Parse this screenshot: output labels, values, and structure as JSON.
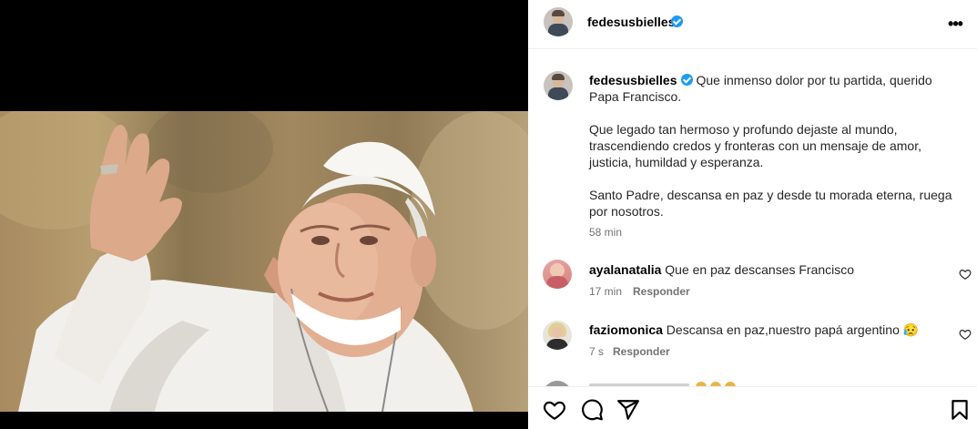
{
  "post": {
    "username": "fedesusbielles",
    "more_icon": "more-horizontal-icon",
    "caption_lines": [
      "Que inmenso dolor por tu partida, querido Papa Francisco.",
      "Que legado tan hermoso y profundo dejaste al mundo, trascendiendo credos y fronteras con un mensaje de amor, justicia, humildad y esperanza.",
      "Santo Padre, descansa en paz y desde tu morada eterna, ruega por nosotros."
    ],
    "time": "58 min"
  },
  "comments": [
    {
      "username": "ayalanatalia",
      "text": "Que en paz descanses Francisco",
      "time": "17 min",
      "reply": "Responder"
    },
    {
      "username": "faziomonica",
      "text": "Descansa en paz,nuestro papá argentino 😥",
      "time": "7 s",
      "reply": "Responder"
    }
  ],
  "actions": {
    "like_icon": "heart-icon",
    "comment_icon": "comment-icon",
    "share_icon": "share-icon",
    "save_icon": "bookmark-icon"
  }
}
